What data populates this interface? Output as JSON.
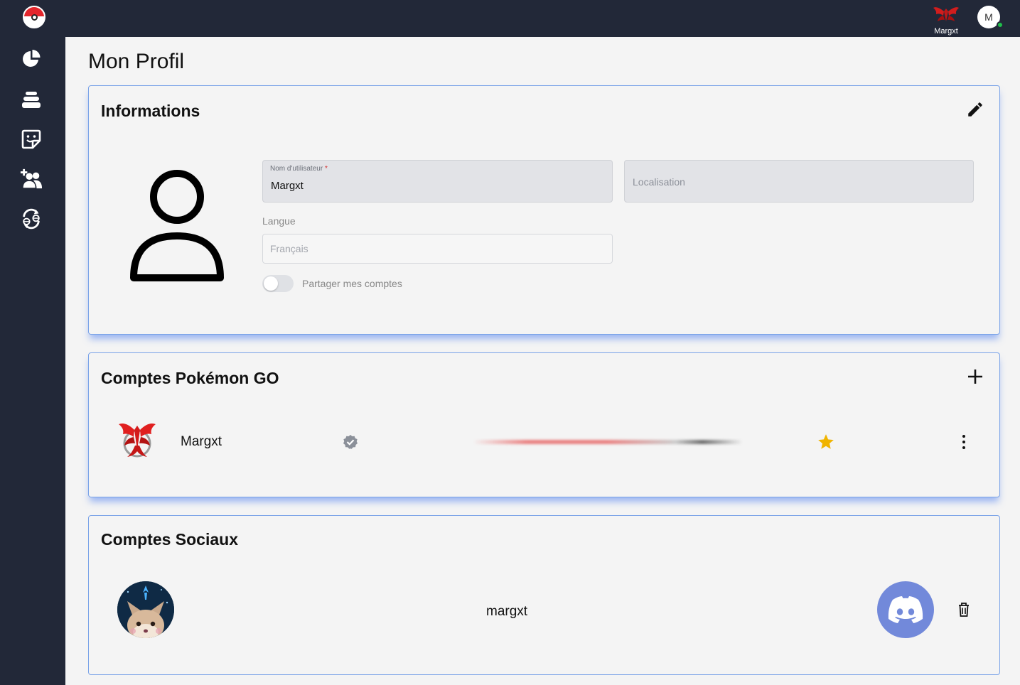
{
  "header": {
    "team_user": "Margxt",
    "avatar_initial": "M"
  },
  "sidebar": {
    "items": [
      {
        "icon": "pokeball-logo-icon"
      },
      {
        "icon": "pie-chart-icon"
      },
      {
        "icon": "stack-icon"
      },
      {
        "icon": "sticker-face-icon"
      },
      {
        "icon": "add-friend-icon"
      },
      {
        "icon": "trade-icon"
      }
    ]
  },
  "page": {
    "title": "Mon Profil"
  },
  "informations": {
    "title": "Informations",
    "username_label": "Nom d'utilisateur",
    "username_required": "*",
    "username_value": "Margxt",
    "location_placeholder": "Localisation",
    "langue_label": "Langue",
    "langue_placeholder": "Français",
    "share_label": "Partager mes comptes"
  },
  "pokemon_go": {
    "title": "Comptes Pokémon GO",
    "accounts": [
      {
        "name": "Margxt"
      }
    ]
  },
  "social": {
    "title": "Comptes Sociaux",
    "accounts": [
      {
        "name": "margxt"
      }
    ]
  },
  "colors": {
    "sidebar_bg": "#222838",
    "card_border": "#7aa3e8",
    "discord": "#7289da",
    "star": "#f0b400",
    "online": "#1fbf4a"
  }
}
